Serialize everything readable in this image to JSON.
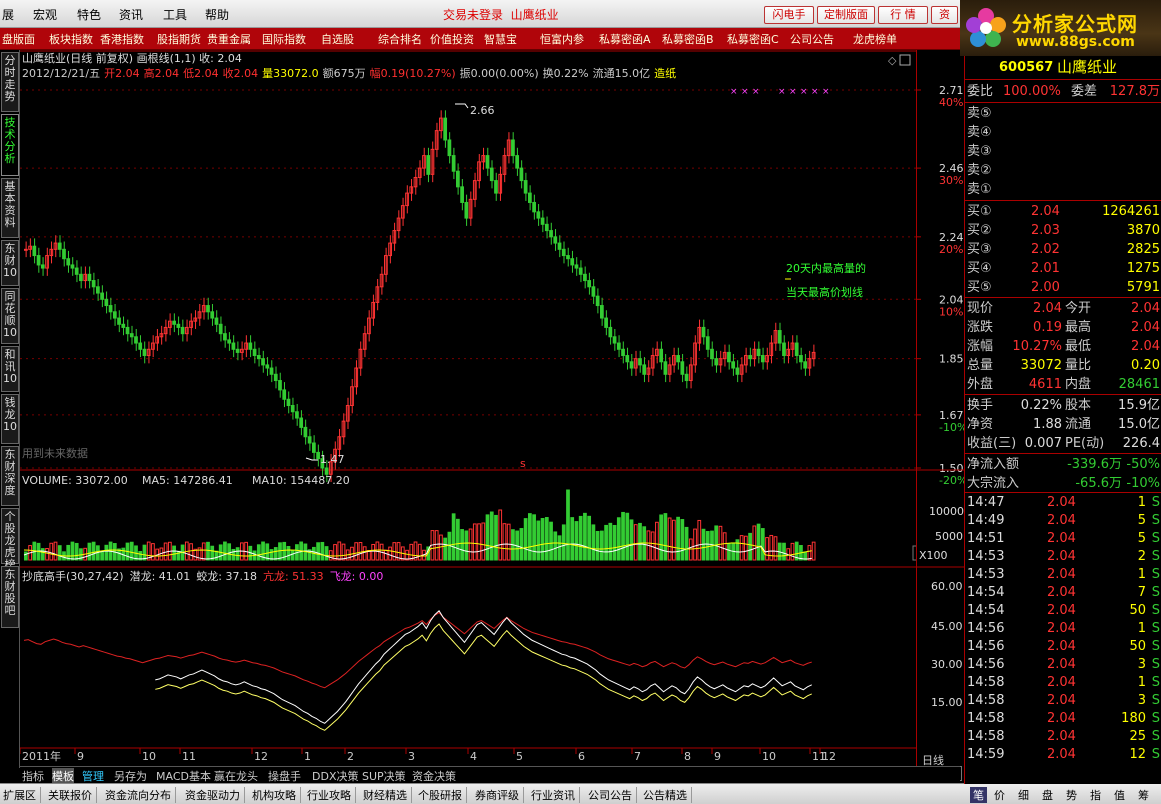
{
  "menu": {
    "items": [
      "展",
      "宏观",
      "特色",
      "资讯",
      "工具",
      "帮助"
    ],
    "login_status": "交易未登录",
    "stock_title": "山鹰纸业",
    "buttons": [
      "闪电手",
      "定制版面",
      "行 情",
      "资"
    ]
  },
  "logo": {
    "name": "分析家公式网",
    "url": "www.88gs.com"
  },
  "tabs": [
    "盘版面",
    "板块指数",
    "香港指数",
    "股指期货",
    "贵重金属",
    "国际指数",
    "自选股",
    "综合排名",
    "价值投资",
    "智慧宝",
    "恒富内参",
    "私募密函A",
    "私募密函B",
    "私募密函C",
    "公司公告",
    "龙虎榜单"
  ],
  "left_tabs": [
    "分时走势",
    "技术分析",
    "基本资料",
    "东财10",
    "同花顺10",
    "和讯10",
    "钱龙10",
    "东财深度",
    "个股龙虎榜",
    "东财股吧"
  ],
  "main": {
    "header1": "山鹰纸业(日线 前复权) 画根线(1,1)  收: 2.04",
    "date": "2012/12/21/五",
    "quote": [
      {
        "text": "开2.04",
        "color": "#ff3030"
      },
      {
        "text": "高2.04",
        "color": "#ff3030"
      },
      {
        "text": "低2.04",
        "color": "#ff3030"
      },
      {
        "text": "收2.04",
        "color": "#ff3030"
      },
      {
        "text": "量33072.0",
        "color": "#ffff00"
      },
      {
        "text": "额675万",
        "color": "#cccccc"
      },
      {
        "text": "幅0.19(10.27%)",
        "color": "#ff3030"
      },
      {
        "text": "振0.00(0.00%)",
        "color": "#cccccc"
      },
      {
        "text": "换0.22%",
        "color": "#cccccc"
      },
      {
        "text": "流通15.0亿",
        "color": "#cccccc"
      },
      {
        "text": "造纸",
        "color": "#ffff00"
      }
    ],
    "annot_high": "2.66",
    "annot_low": "1.47",
    "annot_note1": "20天内最高量的",
    "annot_note2": "当天最高价划线",
    "future_note": "用到未来数据",
    "marker": "s",
    "price_axis": [
      {
        "v": "2.71",
        "p": "40%"
      },
      {
        "v": "2.46",
        "p": "30%"
      },
      {
        "v": "2.24",
        "p": "20%"
      },
      {
        "v": "2.04",
        "p": "10%"
      },
      {
        "v": "1.85",
        "p": ""
      },
      {
        "v": "1.67",
        "p": "-10%"
      },
      {
        "v": "1.50",
        "p": "-20%"
      }
    ]
  },
  "volume": {
    "label": "VOLUME: 33072.00",
    "ma5": "MA5: 147286.41",
    "ma10": "MA10: 154487.20",
    "axis": [
      "10000",
      "5000"
    ],
    "unit": "X100"
  },
  "indicator": {
    "label": "抄底高手(30,27,42)",
    "l1": "潜龙: 41.01",
    "l2": "蛟龙: 37.18",
    "l3": "亢龙: 51.33",
    "l4": "飞龙: 0.00",
    "axis": [
      "60.00",
      "45.00",
      "30.00",
      "15.00"
    ]
  },
  "xaxis": [
    "2011年",
    "9",
    "10",
    "11",
    "12",
    "1",
    "2",
    "3",
    "4",
    "5",
    "6",
    "7",
    "8",
    "9",
    "10",
    "11",
    "12"
  ],
  "period": "日线",
  "panel": {
    "code": "600567",
    "name": "山鹰纸业",
    "weibi": "委比",
    "weibi_v": "100.00%",
    "weicha": "委差",
    "weicha_v": "127.8万",
    "sell": [
      "卖⑤",
      "卖④",
      "卖③",
      "卖②",
      "卖①"
    ],
    "buy": [
      {
        "l": "买①",
        "p": "2.04",
        "v": "1264261"
      },
      {
        "l": "买②",
        "p": "2.03",
        "v": "3870"
      },
      {
        "l": "买③",
        "p": "2.02",
        "v": "2825"
      },
      {
        "l": "买④",
        "p": "2.01",
        "v": "1275"
      },
      {
        "l": "买⑤",
        "p": "2.00",
        "v": "5791"
      }
    ],
    "stats": [
      {
        "a": "现价",
        "av": "2.04",
        "b": "今开",
        "bv": "2.04"
      },
      {
        "a": "涨跌",
        "av": "0.19",
        "b": "最高",
        "bv": "2.04"
      },
      {
        "a": "涨幅",
        "av": "10.27%",
        "b": "最低",
        "bv": "2.04"
      },
      {
        "a": "总量",
        "av": "33072",
        "b": "量比",
        "bv": "0.20"
      },
      {
        "a": "外盘",
        "av": "4611",
        "b": "内盘",
        "bv": "28461"
      }
    ],
    "stats2": [
      {
        "a": "换手",
        "av": "0.22%",
        "b": "股本",
        "bv": "15.9亿"
      },
      {
        "a": "净资",
        "av": "1.88",
        "b": "流通",
        "bv": "15.0亿"
      },
      {
        "a": "收益(三)",
        "av": "0.007",
        "b": "PE(动)",
        "bv": "226.4"
      }
    ],
    "flow": [
      {
        "l": "净流入额",
        "v": "-339.6万",
        "p": "-50%"
      },
      {
        "l": "大宗流入",
        "v": "-65.6万",
        "p": "-10%"
      }
    ],
    "ticks": [
      {
        "t": "14:47",
        "p": "2.04",
        "v": "1",
        "s": "S"
      },
      {
        "t": "14:49",
        "p": "2.04",
        "v": "5",
        "s": "S"
      },
      {
        "t": "14:51",
        "p": "2.04",
        "v": "5",
        "s": "S"
      },
      {
        "t": "14:53",
        "p": "2.04",
        "v": "2",
        "s": "S"
      },
      {
        "t": "14:53",
        "p": "2.04",
        "v": "1",
        "s": "S"
      },
      {
        "t": "14:54",
        "p": "2.04",
        "v": "7",
        "s": "S"
      },
      {
        "t": "14:54",
        "p": "2.04",
        "v": "50",
        "s": "S"
      },
      {
        "t": "14:56",
        "p": "2.04",
        "v": "1",
        "s": "S"
      },
      {
        "t": "14:56",
        "p": "2.04",
        "v": "50",
        "s": "S"
      },
      {
        "t": "14:56",
        "p": "2.04",
        "v": "3",
        "s": "S"
      },
      {
        "t": "14:58",
        "p": "2.04",
        "v": "1",
        "s": "S"
      },
      {
        "t": "14:58",
        "p": "2.04",
        "v": "3",
        "s": "S"
      },
      {
        "t": "14:58",
        "p": "2.04",
        "v": "180",
        "s": "S"
      },
      {
        "t": "14:58",
        "p": "2.04",
        "v": "25",
        "s": "S"
      },
      {
        "t": "14:59",
        "p": "2.04",
        "v": "12",
        "s": "S"
      }
    ],
    "tabs": [
      "笔",
      "价",
      "细",
      "盘",
      "势",
      "指",
      "值",
      "筹"
    ]
  },
  "bottom1": [
    "指标",
    "模板",
    "管理",
    "另存为",
    "MACD基本",
    "赢在龙头",
    "操盘手",
    "DDX决策",
    "SUP决策",
    "资金决策"
  ],
  "bottom2": [
    "扩展区",
    "关联报价",
    "资金流向分布",
    "资金驱动力",
    "机构攻略",
    "行业攻略",
    "财经精选",
    "个股研报",
    "券商评级",
    "行业资讯",
    "公司公告",
    "公告精选"
  ]
}
